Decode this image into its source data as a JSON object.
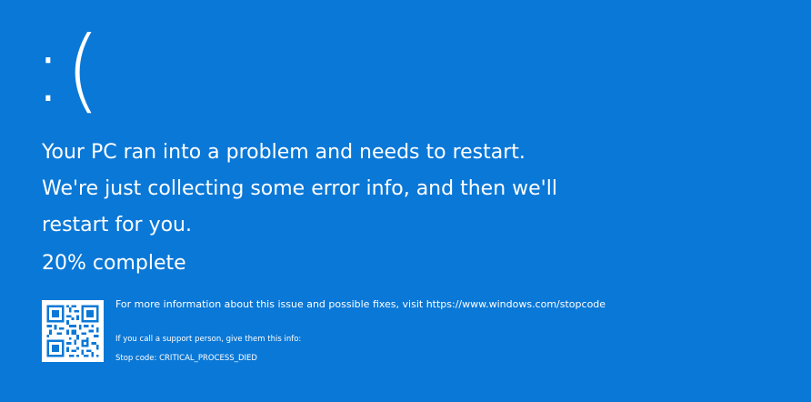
{
  "screen": {
    "background_color": "#0a78d7",
    "text_color": "#ffffff",
    "sad_face": ":(",
    "message": "Your PC ran into a problem and needs to restart. We're just collecting some error info, and then we'll restart for you.",
    "progress_percent": 20,
    "progress_text": "20% complete",
    "qr_icon": "qr-code-icon",
    "info_url_text": "For more information about this issue and possible fixes, visit https://www.windows.com/stopcode",
    "support_text": "If you call a support person, give them this info:",
    "stop_code_text": "Stop code: CRITICAL_PROCESS_DIED"
  }
}
